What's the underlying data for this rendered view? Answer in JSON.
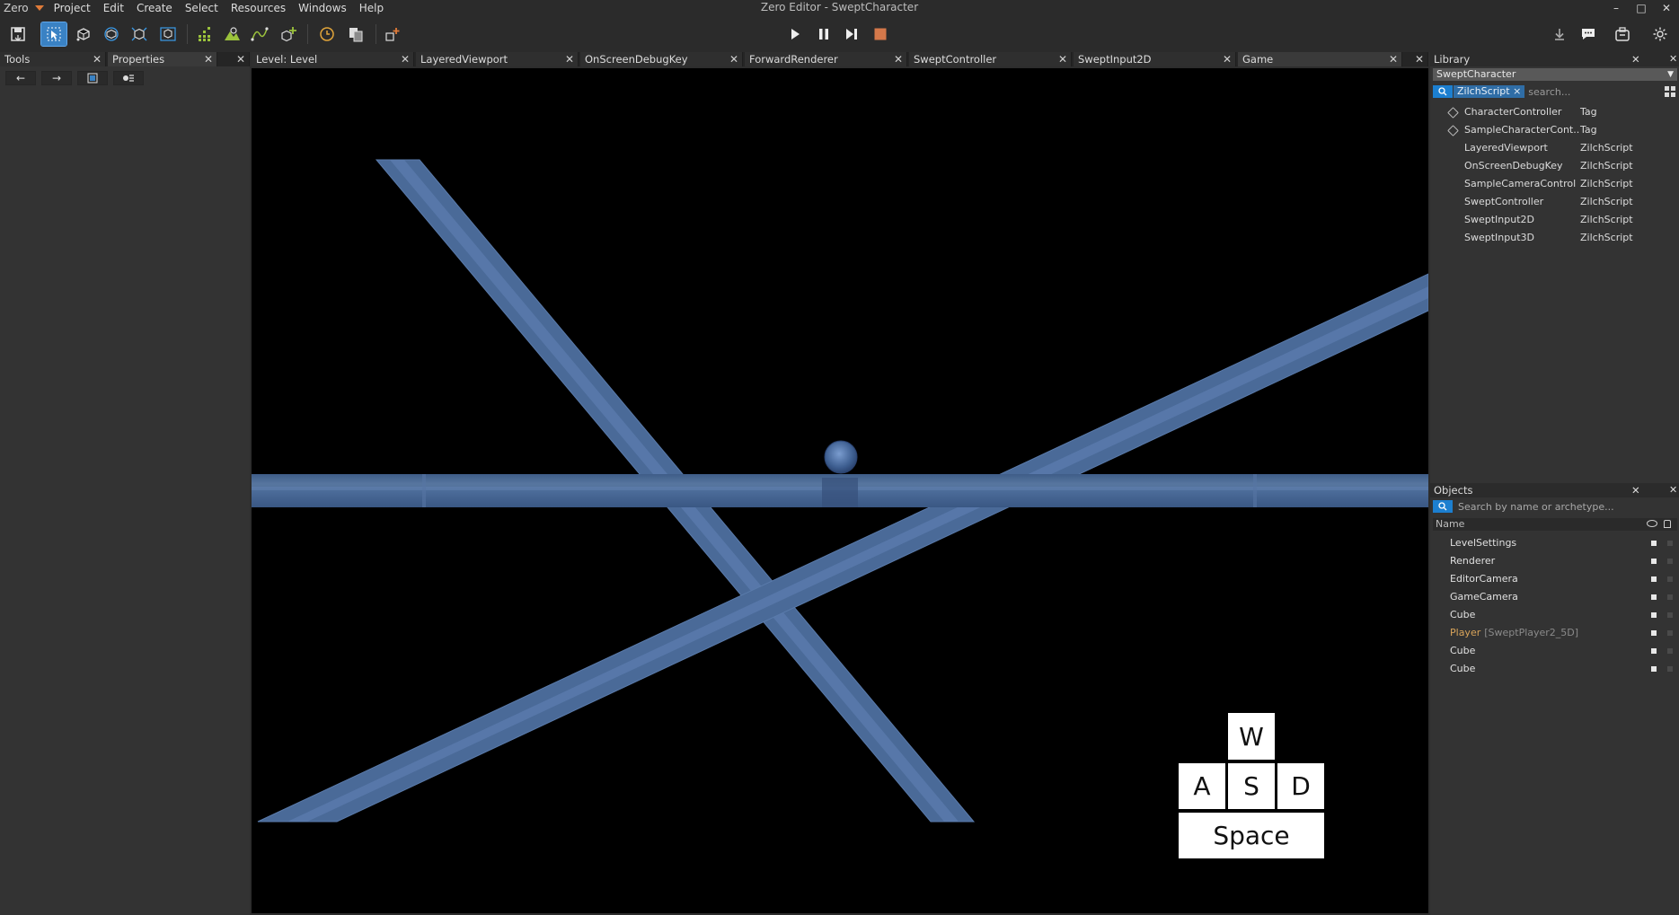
{
  "app": {
    "logo": "Zero",
    "window_title": "Zero Editor - SweptCharacter",
    "menu": [
      "Project",
      "Edit",
      "Create",
      "Select",
      "Resources",
      "Windows",
      "Help"
    ]
  },
  "window_controls": {
    "minimize": "–",
    "maximize": "□",
    "close": "✕"
  },
  "left_tabs": [
    {
      "label": "Tools"
    },
    {
      "label": "Properties"
    }
  ],
  "nav": {
    "back": "←",
    "forward": "→"
  },
  "editor_tabs": [
    {
      "label": "Level: Level"
    },
    {
      "label": "LayeredViewport"
    },
    {
      "label": "OnScreenDebugKey"
    },
    {
      "label": "ForwardRenderer"
    },
    {
      "label": "SweptController"
    },
    {
      "label": "SweptInput2D"
    },
    {
      "label": "Game"
    }
  ],
  "close_glyph": "✕",
  "keys": {
    "w": "W",
    "a": "A",
    "s": "S",
    "d": "D",
    "space": "Space"
  },
  "library": {
    "header": "Library",
    "selected": "SweptCharacter",
    "filter_tag": "ZilchScript ×",
    "search_placeholder": "search...",
    "items": [
      {
        "name": "CharacterController",
        "type": "Tag",
        "tag": true
      },
      {
        "name": "SampleCharacterCont...",
        "type": "Tag",
        "tag": true
      },
      {
        "name": "LayeredViewport",
        "type": "ZilchScript",
        "tag": false
      },
      {
        "name": "OnScreenDebugKey",
        "type": "ZilchScript",
        "tag": false
      },
      {
        "name": "SampleCameraControl",
        "type": "ZilchScript",
        "tag": false
      },
      {
        "name": "SweptController",
        "type": "ZilchScript",
        "tag": false
      },
      {
        "name": "SweptInput2D",
        "type": "ZilchScript",
        "tag": false
      },
      {
        "name": "SweptInput3D",
        "type": "ZilchScript",
        "tag": false
      }
    ]
  },
  "objects": {
    "header": "Objects",
    "search_placeholder": "Search by name or archetype...",
    "column_name": "Name",
    "items": [
      {
        "name": "LevelSettings",
        "archetype": ""
      },
      {
        "name": "Renderer",
        "archetype": ""
      },
      {
        "name": "EditorCamera",
        "archetype": ""
      },
      {
        "name": "GameCamera",
        "archetype": ""
      },
      {
        "name": "Cube",
        "archetype": ""
      },
      {
        "name": "Player",
        "archetype": "[SweptPlayer2_5D]"
      },
      {
        "name": "Cube",
        "archetype": ""
      },
      {
        "name": "Cube",
        "archetype": ""
      }
    ]
  },
  "colors": {
    "accent": "#3a82c4",
    "platform": "#4a6a98",
    "archetype_object": "#d9a45a",
    "stop_button": "#d4784a"
  }
}
